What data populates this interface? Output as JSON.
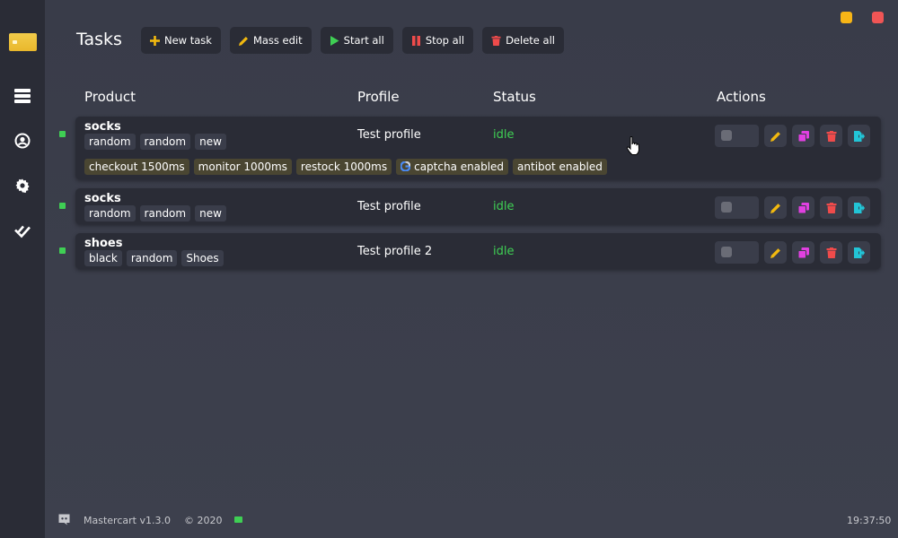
{
  "page": {
    "title": "Tasks"
  },
  "toolbar": {
    "new_task": "New task",
    "mass_edit": "Mass edit",
    "start_all": "Start all",
    "stop_all": "Stop all",
    "delete_all": "Delete all"
  },
  "columns": {
    "product": "Product",
    "profile": "Profile",
    "status": "Status",
    "actions": "Actions"
  },
  "tasks": [
    {
      "product": "socks",
      "tags": [
        "random",
        "random",
        "new"
      ],
      "options": [
        "checkout 1500ms",
        "monitor 1000ms",
        "restock 1000ms",
        "captcha enabled",
        "antibot enabled"
      ],
      "profile": "Test profile",
      "status": "idle"
    },
    {
      "product": "socks",
      "tags": [
        "random",
        "random",
        "new"
      ],
      "profile": "Test profile",
      "status": "idle"
    },
    {
      "product": "shoes",
      "tags": [
        "black",
        "random",
        "Shoes"
      ],
      "profile": "Test profile 2",
      "status": "idle"
    }
  ],
  "footer": {
    "version": "Mastercart v1.3.0",
    "copyright": "© 2020",
    "time": "19:37:50"
  },
  "colors": {
    "accent_yellow": "#f2b90f",
    "status_green": "#3fcf54",
    "pink": "#e040e0",
    "red": "#ef4b4b",
    "cyan": "#22c4d6"
  },
  "icons": {
    "sidebar": [
      "tasks-list-icon",
      "profile-icon",
      "settings-gear-icon",
      "check-icon"
    ]
  }
}
